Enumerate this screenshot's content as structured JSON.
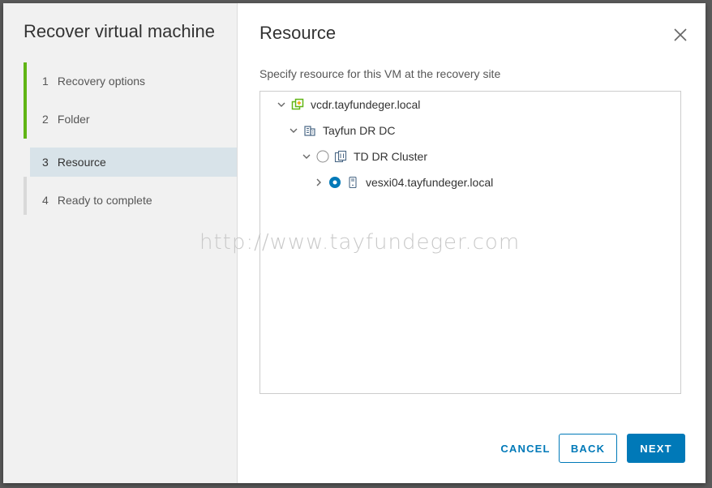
{
  "wizard": {
    "title": "Recover virtual machine",
    "steps": [
      {
        "number": "1",
        "label": "Recovery options",
        "state": "done"
      },
      {
        "number": "2",
        "label": "Folder",
        "state": "done"
      },
      {
        "number": "3",
        "label": "Resource",
        "state": "active"
      },
      {
        "number": "4",
        "label": "Ready to complete",
        "state": "pending"
      }
    ]
  },
  "page": {
    "title": "Resource",
    "instruction": "Specify resource for this VM at the recovery site"
  },
  "tree": {
    "nodes": [
      {
        "label": "vcdr.tayfundeger.local",
        "icon": "vcenter-icon",
        "expanded": true
      },
      {
        "label": "Tayfun DR DC",
        "icon": "datacenter-icon",
        "expanded": true
      },
      {
        "label": "TD DR Cluster",
        "icon": "cluster-icon",
        "expanded": true,
        "selected": false
      },
      {
        "label": "vesxi04.tayfundeger.local",
        "icon": "host-icon",
        "expanded": false,
        "selected": true
      }
    ]
  },
  "watermark": "http://www.tayfundeger.com",
  "footer": {
    "cancel_label": "CANCEL",
    "back_label": "BACK",
    "next_label": "NEXT"
  },
  "colors": {
    "accent": "#0079b8",
    "step_done": "#60b515",
    "vcenter_icon": "#60b515"
  }
}
